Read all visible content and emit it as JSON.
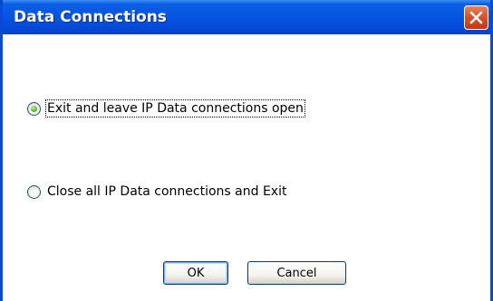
{
  "window": {
    "title": "Data Connections"
  },
  "options": [
    {
      "label": "Exit and leave IP Data connections open",
      "checked": true
    },
    {
      "label": "Close all IP Data connections and Exit",
      "checked": false
    }
  ],
  "buttons": {
    "ok_label": "OK",
    "cancel_label": "Cancel"
  },
  "icons": {
    "close": "close-icon"
  },
  "colors": {
    "titlebar": "#0554e2",
    "close_button": "#d9532a",
    "radio_selected": "#5dbb23"
  }
}
